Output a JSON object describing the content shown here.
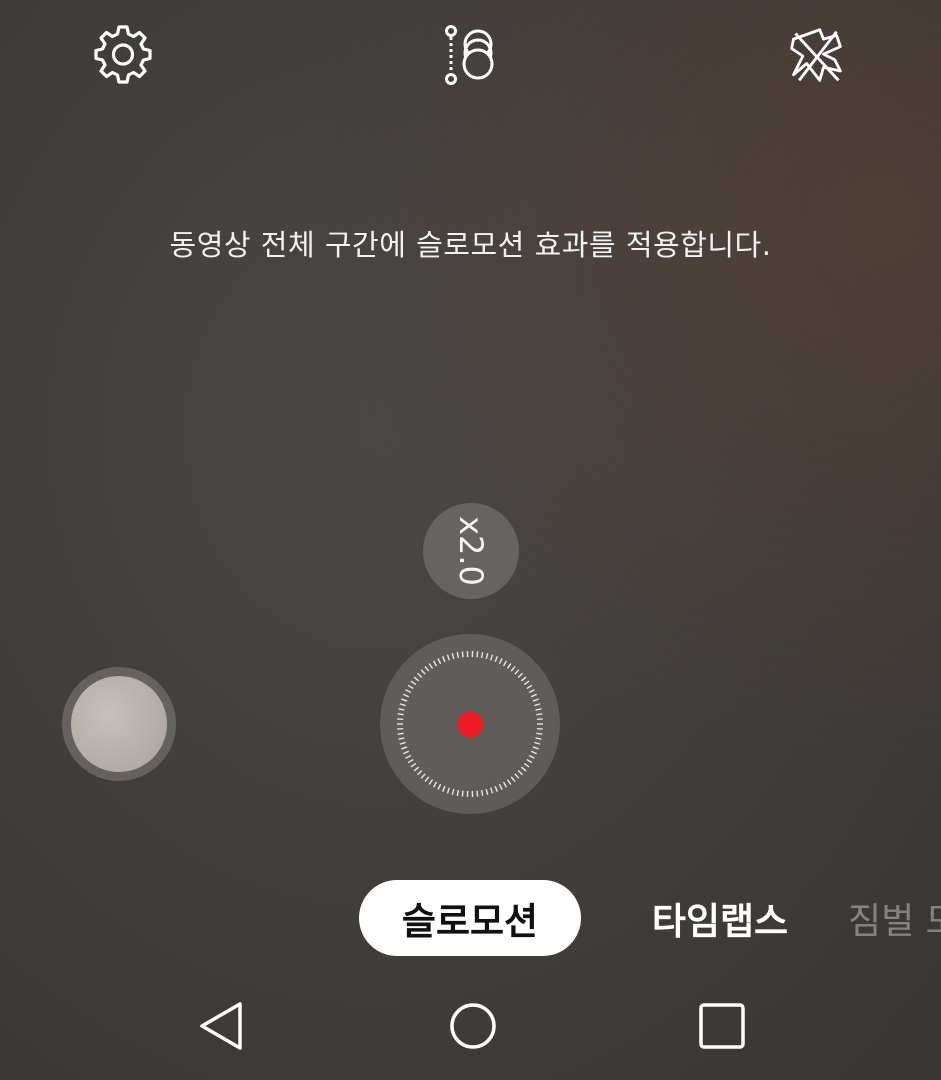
{
  "top_bar": {
    "settings_icon": "gear-icon",
    "multi_icon": "multi-shot-icon",
    "mute_icon": "sound-off-icon"
  },
  "hint_text": "동영상 전체 구간에 슬로모션 효과를 적용합니다.",
  "zoom_label": "x2.0",
  "record_color": "#ee1c25",
  "modes": [
    {
      "label": "슬로모션",
      "selected": true
    },
    {
      "label": "타임랩스",
      "selected": false
    },
    {
      "label": "짐벌 모",
      "selected": false
    }
  ],
  "nav": {
    "back_icon": "back-triangle-icon",
    "home_icon": "home-circle-icon",
    "recent_icon": "recent-square-icon"
  }
}
